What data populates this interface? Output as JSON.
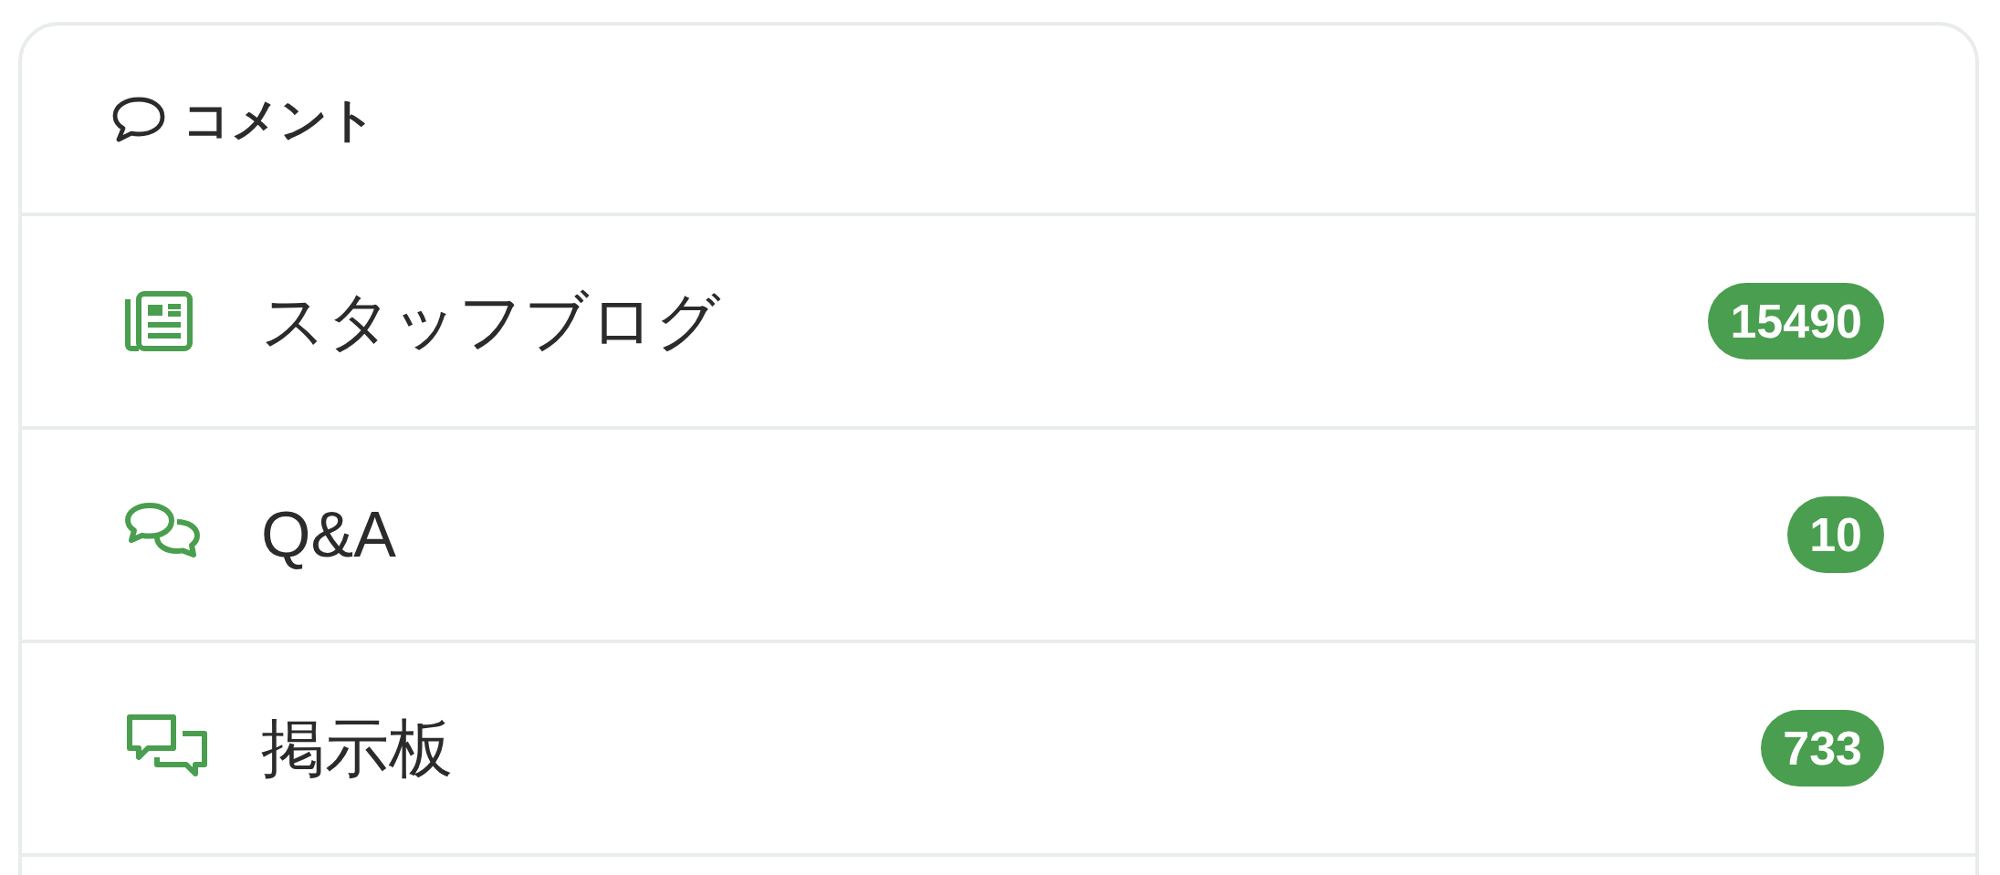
{
  "header": {
    "title": "コメント"
  },
  "items": [
    {
      "kind": "blog",
      "label": "スタッフブログ",
      "count": "15490"
    },
    {
      "kind": "qa",
      "label": "Q&A",
      "count": "10"
    },
    {
      "kind": "board",
      "label": "掲示板",
      "count": "733"
    }
  ]
}
